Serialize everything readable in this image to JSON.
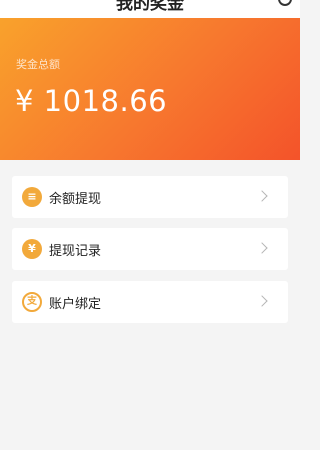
{
  "header": {
    "title": "我的奖金",
    "help_icon": "help-icon"
  },
  "balance": {
    "label": "奖金总额",
    "amount": "¥ 1018.66"
  },
  "menu": {
    "items": [
      {
        "label": "余额提现",
        "icon": "wallet-icon",
        "icon_glyph": "≡"
      },
      {
        "label": "提现记录",
        "icon": "yen-record-icon",
        "icon_glyph": "¥"
      },
      {
        "label": "账户绑定",
        "icon": "alipay-icon",
        "icon_glyph": "支"
      }
    ]
  },
  "colors": {
    "accent": "#f7772e",
    "icon": "#f2a93b",
    "background": "#f4f4f4"
  }
}
